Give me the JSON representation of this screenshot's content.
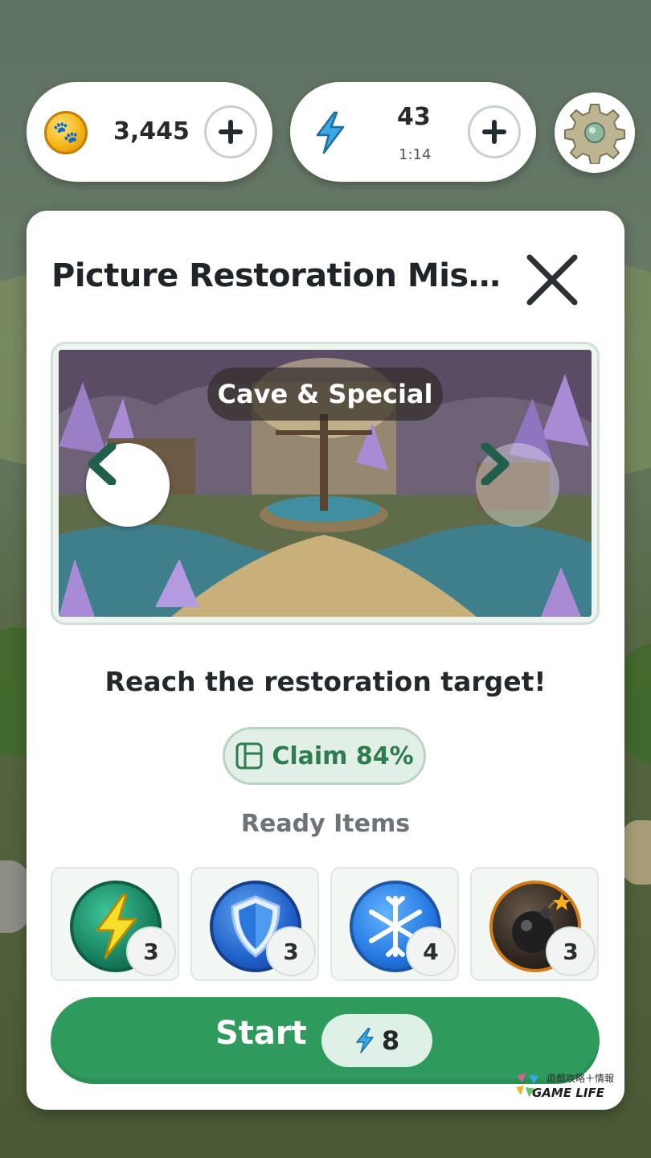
{
  "hud": {
    "coins": "3,445",
    "energy": "43",
    "energy_timer": "1:14"
  },
  "dialog": {
    "title": "Picture Restoration Missi...",
    "picture_label": "Cave & Special",
    "subtitle": "Reach the restoration target!",
    "claim_text": "Claim 84%",
    "ready_items_label": "Ready Items",
    "items": [
      {
        "icon": "lightning-boost-icon",
        "count": "3",
        "color": "#1f8f6e"
      },
      {
        "icon": "shield-icon",
        "count": "3",
        "color": "#2a6fd6"
      },
      {
        "icon": "snowflake-icon",
        "count": "4",
        "color": "#2b7fe0"
      },
      {
        "icon": "bomb-icon",
        "count": "3",
        "color": "#2d2d2d"
      }
    ],
    "start_label": "Start",
    "start_cost": "8"
  },
  "colors": {
    "accent_green": "#2e9b5d",
    "claim_green": "#2e7d4f",
    "energy_blue": "#3aa7e6",
    "coin_gold": "#f5b517"
  },
  "watermark": {
    "cn": "遊戲攻略＋情報",
    "en": "GAME LIFE"
  }
}
